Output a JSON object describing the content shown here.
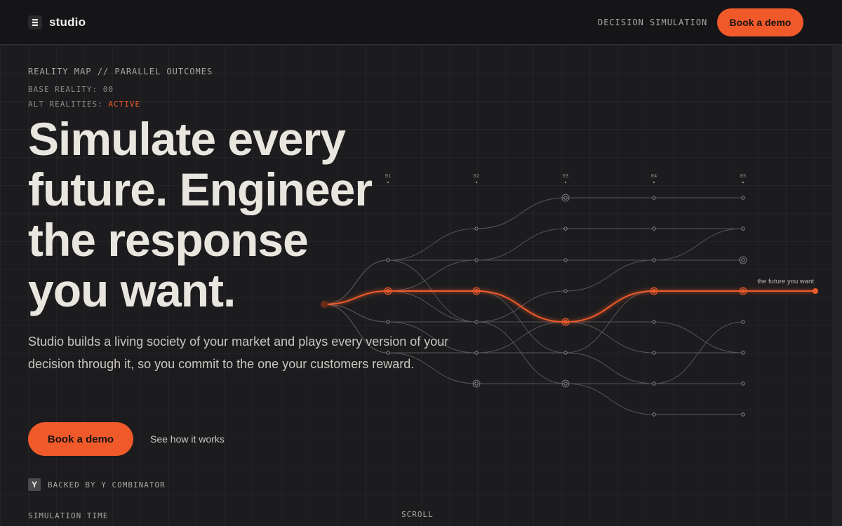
{
  "header": {
    "brand": "studio",
    "nav_link": "DECISION SIMULATION",
    "cta": "Book a demo"
  },
  "hero": {
    "eyebrow": "REALITY MAP // PARALLEL OUTCOMES",
    "base_reality_label": "BASE REALITY:",
    "base_reality_value": "00",
    "alt_realities_label": "ALT REALITIES:",
    "alt_realities_value": "ACTIVE",
    "headline_1": "Simulate every",
    "headline_2": "future. Engineer",
    "headline_3": "the response",
    "headline_4": "you want.",
    "subheadline": "Studio builds a living society of your market and plays every version of your decision through it, so you commit to the one your customers reward.",
    "primary_cta": "Book a demo",
    "secondary_cta": "See how it works"
  },
  "backing": {
    "badge": "Y",
    "text": "BACKED BY Y COMBINATOR"
  },
  "footer": {
    "simulation_time": "SIMULATION TIME",
    "scroll": "SCROLL"
  },
  "reality_map": {
    "column_labels": [
      "01",
      "02",
      "03",
      "04",
      "05"
    ],
    "highlight_label": "the future you want",
    "accent_color": "#f05a2b"
  }
}
